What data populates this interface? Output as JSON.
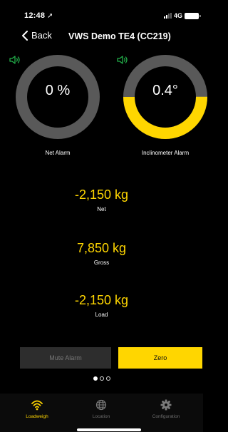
{
  "status": {
    "time": "12:48",
    "network": "4G"
  },
  "nav": {
    "back_label": "Back",
    "title": "VWS Demo TE4 (CC219)"
  },
  "gauges": [
    {
      "value": "0 %",
      "label": "Net Alarm",
      "fill_fraction": 0,
      "sound": "speaker-on"
    },
    {
      "value": "0.4°",
      "label": "Inclinometer Alarm",
      "fill_fraction": 0.5,
      "sound": "speaker-on"
    }
  ],
  "readings": [
    {
      "value": "-2,150 kg",
      "label": "Net"
    },
    {
      "value": "7,850 kg",
      "label": "Gross"
    },
    {
      "value": "-2,150 kg",
      "label": "Load"
    }
  ],
  "buttons": {
    "mute": "Mute Alarm",
    "zero": "Zero"
  },
  "pager": {
    "pages": 3,
    "active": 0
  },
  "tabs": [
    {
      "label": "Loadweigh",
      "icon": "wifi-icon",
      "active": true
    },
    {
      "label": "Location",
      "icon": "globe-icon",
      "active": false
    },
    {
      "label": "Configuration",
      "icon": "gear-icon",
      "active": false
    }
  ],
  "colors": {
    "accent": "#ffd600",
    "track": "#595959",
    "background": "#000000",
    "speaker": "#22b04a"
  }
}
